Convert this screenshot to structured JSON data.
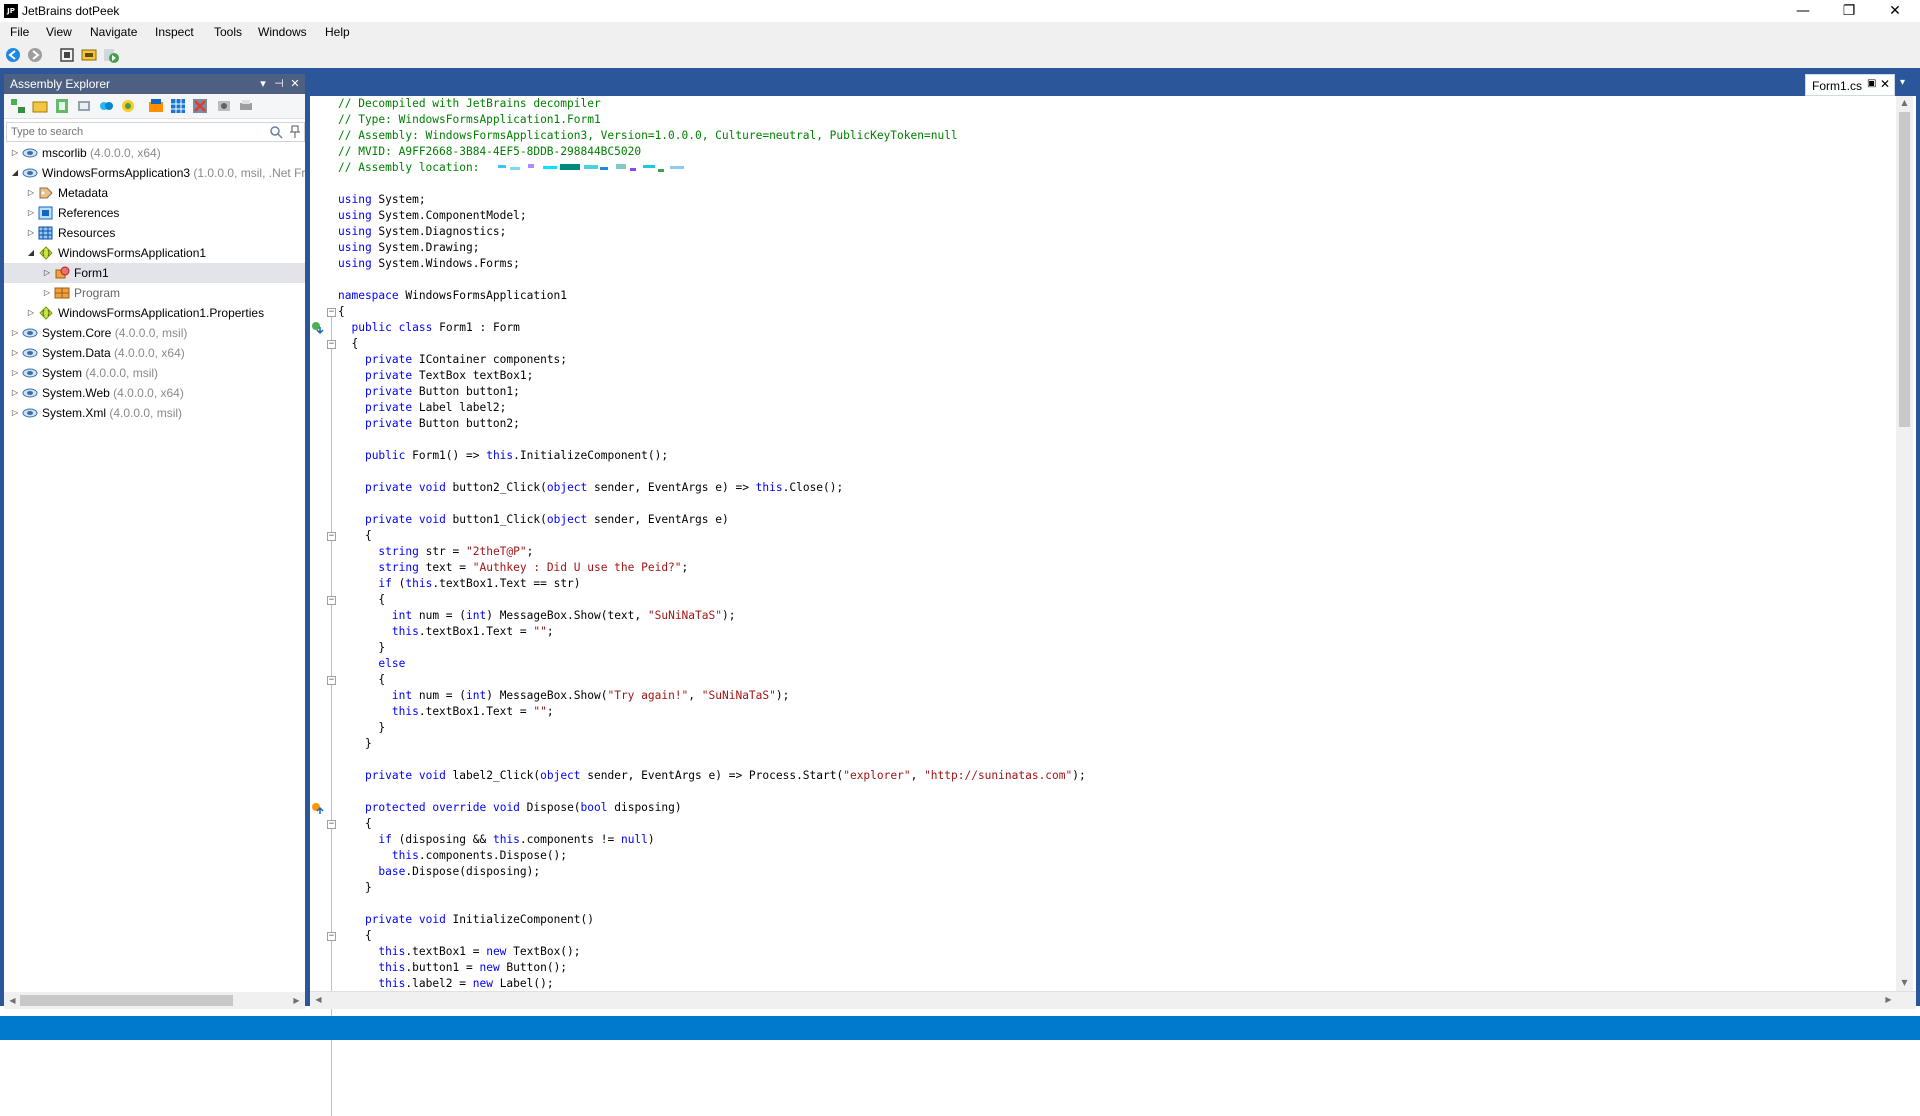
{
  "window": {
    "title": "JetBrains dotPeek",
    "logo_text": "JP",
    "controls": {
      "minimize": "—",
      "maximize": "❐",
      "close": "✕"
    }
  },
  "menu": {
    "items": [
      "File",
      "View",
      "Navigate",
      "Inspect",
      "Tools",
      "Windows",
      "Help"
    ]
  },
  "toolbar": {
    "icons": [
      "back-icon",
      "forward-icon",
      "stop-icon",
      "open-icon",
      "go-icon"
    ]
  },
  "assembly_explorer": {
    "title": "Assembly Explorer",
    "header_buttons": {
      "dropdown": "▾",
      "pin": "📌",
      "close": "✕"
    },
    "search_placeholder": "Type to search",
    "tree": [
      {
        "label": "mscorlib",
        "meta": " (4.0.0.0, x64)",
        "icon": "assembly-icon"
      },
      {
        "label": "WindowsFormsApplication3",
        "meta": " (1.0.0.0, msil, .Net Fra",
        "icon": "assembly-icon"
      },
      {
        "label": "Metadata",
        "meta": "",
        "icon": "metadata-icon"
      },
      {
        "label": "References",
        "meta": "",
        "icon": "references-icon"
      },
      {
        "label": "Resources",
        "meta": "",
        "icon": "resources-icon"
      },
      {
        "label": "WindowsFormsApplication1",
        "meta": "",
        "icon": "namespace-icon"
      },
      {
        "label": "Form1",
        "meta": "",
        "icon": "class-icon"
      },
      {
        "label": "Program",
        "meta": "",
        "icon": "class-icon"
      },
      {
        "label": "WindowsFormsApplication1.Properties",
        "meta": "",
        "icon": "namespace-icon"
      },
      {
        "label": "System.Core",
        "meta": " (4.0.0.0, msil)",
        "icon": "assembly-icon"
      },
      {
        "label": "System.Data",
        "meta": " (4.0.0.0, x64)",
        "icon": "assembly-icon"
      },
      {
        "label": "System",
        "meta": " (4.0.0.0, msil)",
        "icon": "assembly-icon"
      },
      {
        "label": "System.Web",
        "meta": " (4.0.0.0, x64)",
        "icon": "assembly-icon"
      },
      {
        "label": "System.Xml",
        "meta": " (4.0.0.0, msil)",
        "icon": "assembly-icon"
      }
    ]
  },
  "editor": {
    "tab": {
      "label": "Form1.cs",
      "pin": "▣",
      "close": "✕"
    },
    "tab_dropdown": "▾",
    "lines": [
      "// Decompiled with JetBrains decompiler",
      "// Type: WindowsFormsApplication1.Form1",
      "// Assembly: WindowsFormsApplication3, Version=1.0.0.0, Culture=neutral, PublicKeyToken=null",
      "// MVID: A9FF2668-3B84-4EF5-8DDB-298844BC5020",
      "// Assembly location: ",
      "",
      "using System;",
      "using System.ComponentModel;",
      "using System.Diagnostics;",
      "using System.Drawing;",
      "using System.Windows.Forms;",
      "",
      "namespace WindowsFormsApplication1",
      "{",
      "  public class Form1 : Form",
      "  {",
      "    private IContainer components;",
      "    private TextBox textBox1;",
      "    private Button button1;",
      "    private Label label2;",
      "    private Button button2;",
      "",
      "    public Form1() => this.InitializeComponent();",
      "",
      "    private void button2_Click(object sender, EventArgs e) => this.Close();",
      "",
      "    private void button1_Click(object sender, EventArgs e)",
      "    {",
      "      string str = \"2theT@P\";",
      "      string text = \"Authkey : Did U use the Peid?\";",
      "      if (this.textBox1.Text == str)",
      "      {",
      "        int num = (int) MessageBox.Show(text, \"SuNiNaTaS\");",
      "        this.textBox1.Text = \"\";",
      "      }",
      "      else",
      "      {",
      "        int num = (int) MessageBox.Show(\"Try again!\", \"SuNiNaTaS\");",
      "        this.textBox1.Text = \"\";",
      "      }",
      "    }",
      "",
      "    private void label2_Click(object sender, EventArgs e) => Process.Start(\"explorer\", \"http://suninatas.com\");",
      "",
      "    protected override void Dispose(bool disposing)",
      "    {",
      "      if (disposing && this.components != null)",
      "        this.components.Dispose();",
      "      base.Dispose(disposing);",
      "    }",
      "",
      "    private void InitializeComponent()",
      "    {",
      "      this.textBox1 = new TextBox();",
      "      this.button1 = new Button();",
      "      this.label2 = new Label();"
    ]
  },
  "colors": {
    "dock_background": "#2b579a",
    "panel_header": "#4d6082",
    "status_bar": "#007acc",
    "comment": "#008000",
    "keyword": "#0000ff",
    "string": "#a31515"
  }
}
